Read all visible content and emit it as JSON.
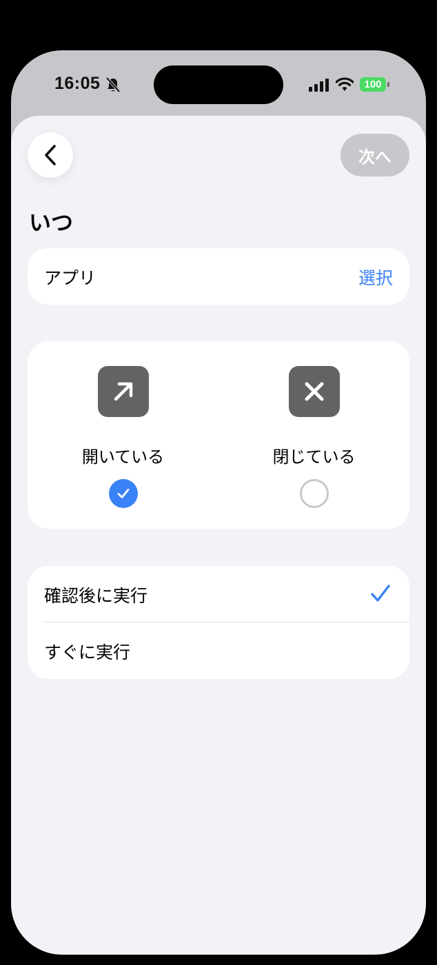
{
  "status_bar": {
    "time": "16:05",
    "battery": "100"
  },
  "nav": {
    "next_label": "次へ"
  },
  "section_title": "いつ",
  "app_row": {
    "label": "アプリ",
    "action": "選択"
  },
  "states": [
    {
      "label": "開いている",
      "icon": "arrow-up-right-icon",
      "selected": true
    },
    {
      "label": "閉じている",
      "icon": "x-icon",
      "selected": false
    }
  ],
  "run_options": [
    {
      "label": "確認後に実行",
      "selected": true
    },
    {
      "label": "すぐに実行",
      "selected": false
    }
  ],
  "colors": {
    "accent": "#3a82f7",
    "background": "#f2f2f7",
    "battery": "#4cd964",
    "icon_tile": "#636366"
  }
}
